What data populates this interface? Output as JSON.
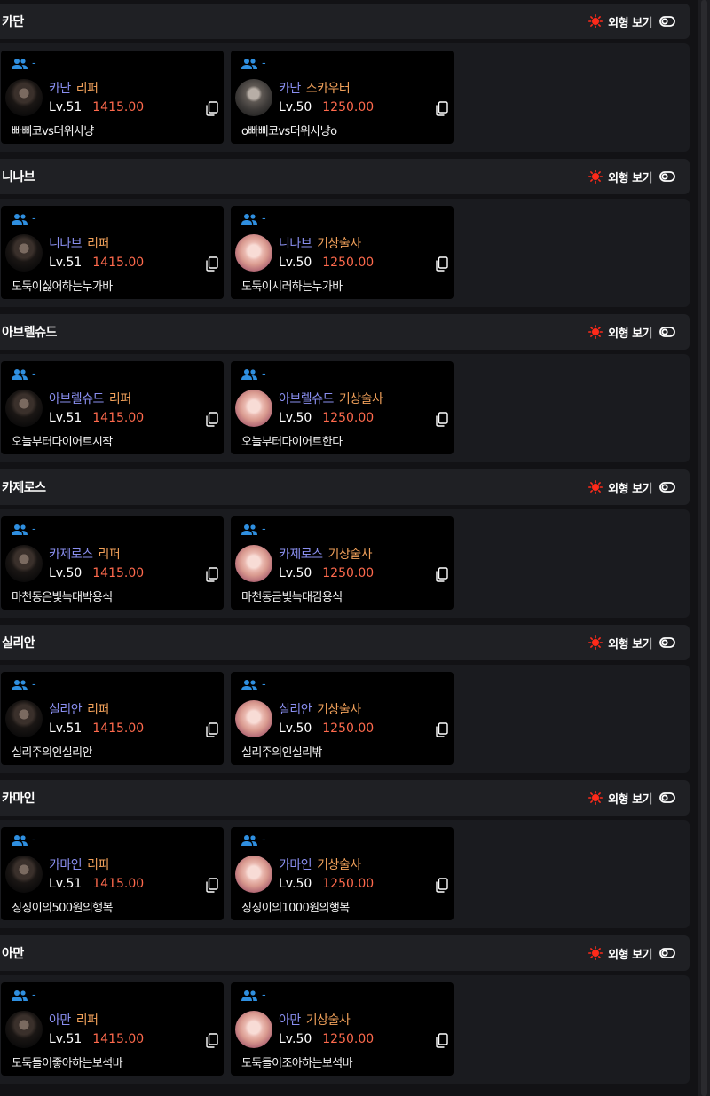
{
  "colors": {
    "accent_red": "#ff2a1a",
    "server_blue": "#8a8ff0",
    "class_orange": "#f0a05a",
    "ilvl_red": "#ff6a4d",
    "party_blue": "#2f8fe0"
  },
  "icons": {
    "toggle_sun": "sun-icon",
    "toggle": "toggle-off-icon",
    "party": "users-icon",
    "copy": "copy-icon"
  },
  "sections": [
    {
      "title": "카단",
      "toggle_label": "외형 보기",
      "cards": [
        {
          "party": "-",
          "server": "카단",
          "class": "리퍼",
          "level": "Lv.51",
          "ilvl": "1415.00",
          "name": "빠삐코vs더위사냥",
          "avatar": "dark"
        },
        {
          "party": "-",
          "server": "카단",
          "class": "스카우터",
          "level": "Lv.50",
          "ilvl": "1250.00",
          "name": "o빠삐코vs더위사냥o",
          "avatar": "gray"
        }
      ]
    },
    {
      "title": "니나브",
      "toggle_label": "외형 보기",
      "cards": [
        {
          "party": "-",
          "server": "니나브",
          "class": "리퍼",
          "level": "Lv.51",
          "ilvl": "1415.00",
          "name": "도둑이싫어하는누가바",
          "avatar": "dark"
        },
        {
          "party": "-",
          "server": "니나브",
          "class": "기상술사",
          "level": "Lv.50",
          "ilvl": "1250.00",
          "name": "도둑이시러하는누가바",
          "avatar": "pink"
        }
      ]
    },
    {
      "title": "아브렐슈드",
      "toggle_label": "외형 보기",
      "cards": [
        {
          "party": "-",
          "server": "아브렐슈드",
          "class": "리퍼",
          "level": "Lv.51",
          "ilvl": "1415.00",
          "name": "오늘부터다이어트시작",
          "avatar": "dark"
        },
        {
          "party": "-",
          "server": "아브렐슈드",
          "class": "기상술사",
          "level": "Lv.50",
          "ilvl": "1250.00",
          "name": "오늘부터다이어트한다",
          "avatar": "pink"
        }
      ]
    },
    {
      "title": "카제로스",
      "toggle_label": "외형 보기",
      "cards": [
        {
          "party": "-",
          "server": "카제로스",
          "class": "리퍼",
          "level": "Lv.50",
          "ilvl": "1415.00",
          "name": "마천동은빛늑대박용식",
          "avatar": "dark"
        },
        {
          "party": "-",
          "server": "카제로스",
          "class": "기상술사",
          "level": "Lv.50",
          "ilvl": "1250.00",
          "name": "마천동금빛늑대김용식",
          "avatar": "pink"
        }
      ]
    },
    {
      "title": "실리안",
      "toggle_label": "외형 보기",
      "cards": [
        {
          "party": "-",
          "server": "실리안",
          "class": "리퍼",
          "level": "Lv.51",
          "ilvl": "1415.00",
          "name": "실리주의인실리안",
          "avatar": "dark"
        },
        {
          "party": "-",
          "server": "실리안",
          "class": "기상술사",
          "level": "Lv.50",
          "ilvl": "1250.00",
          "name": "실리주의인실리밖",
          "avatar": "pink"
        }
      ]
    },
    {
      "title": "카마인",
      "toggle_label": "외형 보기",
      "cards": [
        {
          "party": "-",
          "server": "카마인",
          "class": "리퍼",
          "level": "Lv.51",
          "ilvl": "1415.00",
          "name": "징징이의500원의행복",
          "avatar": "dark"
        },
        {
          "party": "-",
          "server": "카마인",
          "class": "기상술사",
          "level": "Lv.50",
          "ilvl": "1250.00",
          "name": "징징이의1000원의행복",
          "avatar": "pink"
        }
      ]
    },
    {
      "title": "아만",
      "toggle_label": "외형 보기",
      "cards": [
        {
          "party": "-",
          "server": "아만",
          "class": "리퍼",
          "level": "Lv.51",
          "ilvl": "1415.00",
          "name": "도둑들이좋아하는보석바",
          "avatar": "dark"
        },
        {
          "party": "-",
          "server": "아만",
          "class": "기상술사",
          "level": "Lv.50",
          "ilvl": "1250.00",
          "name": "도둑들이조아하는보석바",
          "avatar": "pink"
        }
      ]
    }
  ]
}
